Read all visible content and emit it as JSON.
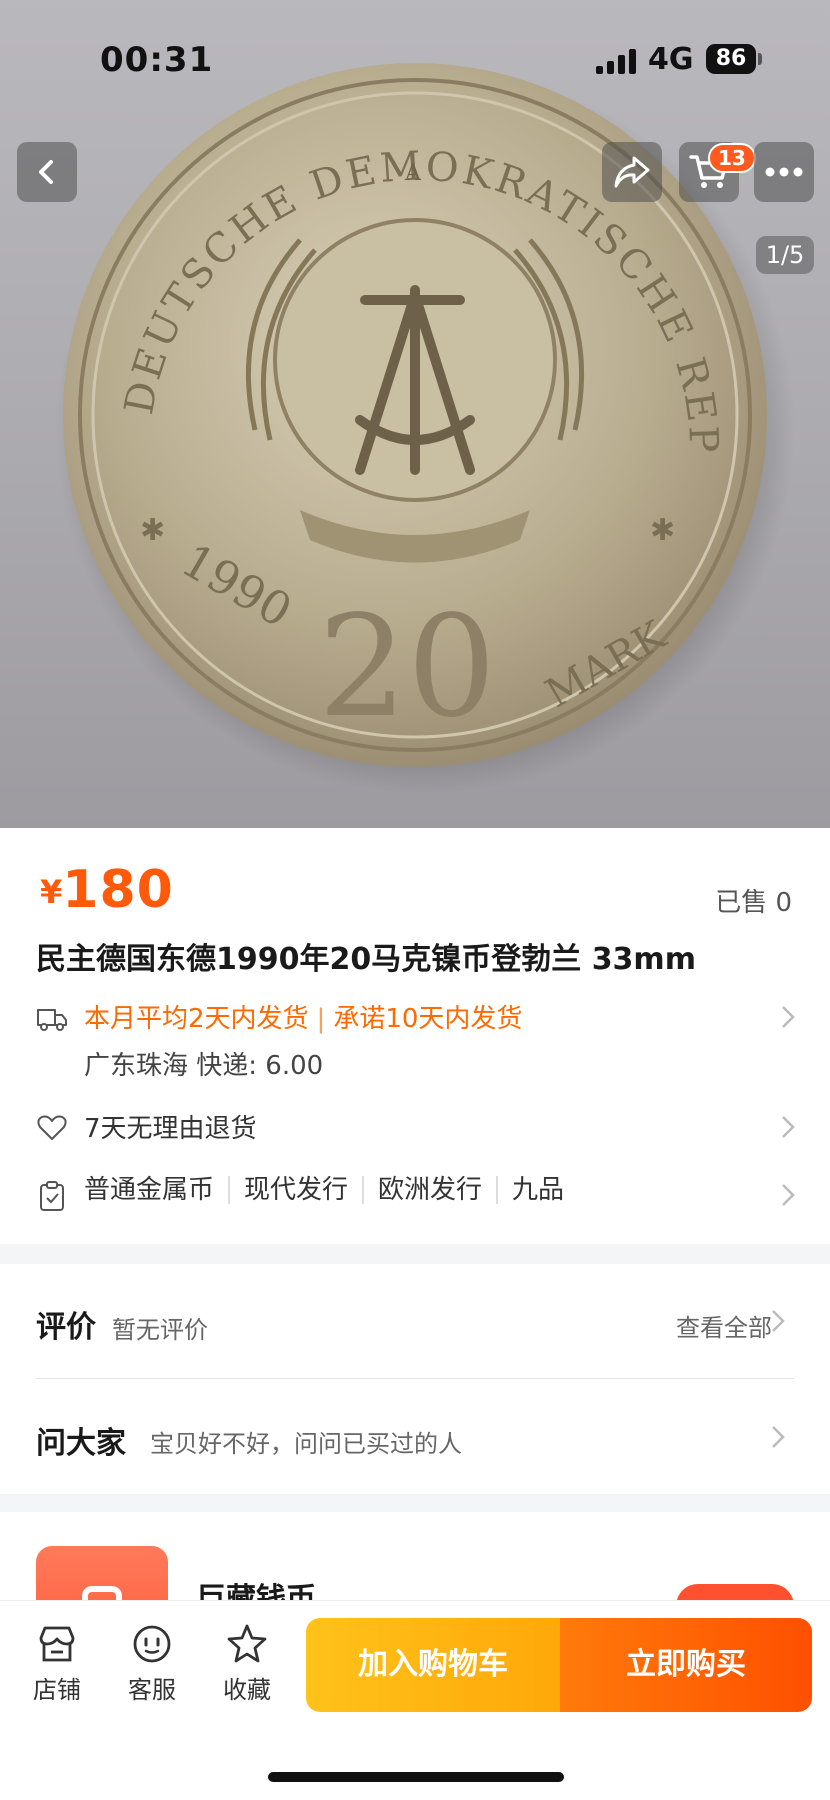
{
  "status_bar": {
    "time": "00:31",
    "network": "4G",
    "battery": "86"
  },
  "gallery": {
    "pager": "1/5",
    "cart_count": "13"
  },
  "coin_image": {
    "top_text": "DEUTSCHE DEMOKRATISCHE REPUBLIK",
    "mint_mark": "A",
    "year": "1990",
    "value": "20",
    "unit": "MARK"
  },
  "product": {
    "currency": "¥",
    "price": "180",
    "sold": "已售 0",
    "title": "民主德国东德1990年20马克镍币登勃兰 33mm"
  },
  "shipping": {
    "avg": "本月平均2天内发货",
    "promise": "承诺10天内发货",
    "origin": "广东珠海  快递: 6.00"
  },
  "returns": {
    "label": "7天无理由退货"
  },
  "attributes": [
    "普通金属币",
    "现代发行",
    "欧洲发行",
    "九品"
  ],
  "reviews": {
    "title": "评价",
    "subtitle": "暂无评价",
    "see_all": "查看全部"
  },
  "qa": {
    "title": "问大家",
    "subtitle": "宝贝好不好，问问已买过的人"
  },
  "store": {
    "name": "巨藏钱币"
  },
  "bottom_bar": {
    "store": "店铺",
    "service": "客服",
    "favorite": "收藏",
    "add_to_cart": "加入购物车",
    "buy_now": "立即购买"
  },
  "colors": {
    "accent": "#ff5a0a",
    "cart_button": "#ffb40f",
    "buy_button": "#ff6000"
  }
}
